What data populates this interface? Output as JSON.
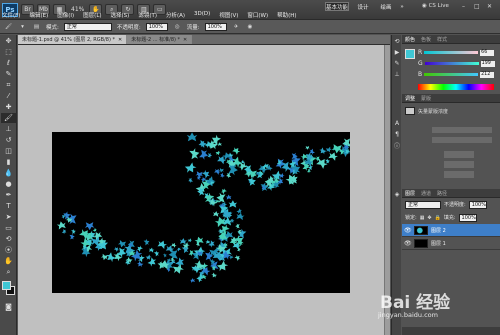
{
  "app": {
    "logo": "Ps",
    "zoom": "41%",
    "menus": [
      "文件(F)",
      "编辑(E)",
      "图像(I)",
      "图层(L)",
      "选择(S)",
      "滤镜(T)",
      "分析(A)",
      "3D(D)",
      "视图(V)",
      "窗口(W)",
      "帮助(H)"
    ],
    "workspaces": {
      "active": "基本功能",
      "second": "设计",
      "third": "绘画",
      "more": "»"
    },
    "cslive": "CS Live"
  },
  "options": {
    "mode_label": "模式:",
    "mode_value": "正常",
    "opacity_label": "不透明度:",
    "opacity_value": "100%",
    "flow_label": "流量:",
    "flow_value": "100%"
  },
  "document": {
    "tabs": [
      {
        "label": "未标题-1.psd @ 41% (图层 2, RGB/8) *"
      },
      {
        "label": "未标题-2 ... 标准/8) *"
      }
    ]
  },
  "color_panel": {
    "tabs": [
      "颜色",
      "色板",
      "样式"
    ],
    "swatch_color": "#3fc7d4",
    "r": "66",
    "g": "199",
    "b": "212"
  },
  "adjust_panel": {
    "tabs": [
      "调整",
      "蒙版"
    ],
    "preset": "矢量蒙版浓度"
  },
  "layers_panel": {
    "tabs": [
      "图层",
      "通道",
      "路径"
    ],
    "blend_mode": "正常",
    "opacity_label": "不透明度:",
    "opacity_value": "100%",
    "fill_label": "填充:",
    "fill_value": "100%",
    "lock_label": "锁定:",
    "layers": [
      {
        "name": "图层 2",
        "selected": true
      },
      {
        "name": "图层 1",
        "selected": false
      }
    ]
  },
  "watermark": {
    "brand": "Bai 经验",
    "url": "jingyan.baidu.com"
  }
}
